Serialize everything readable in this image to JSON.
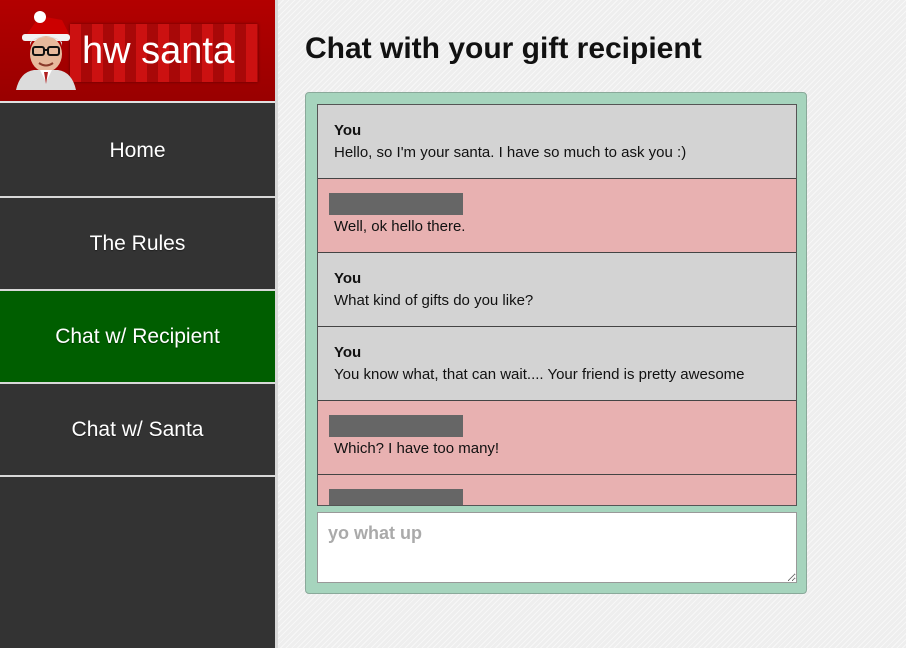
{
  "brand": {
    "logo_text": "hw santa"
  },
  "nav": {
    "items": [
      {
        "label": "Home",
        "active": false
      },
      {
        "label": "The Rules",
        "active": false
      },
      {
        "label": "Chat w/ Recipient",
        "active": true
      },
      {
        "label": "Chat w/ Santa",
        "active": false
      }
    ]
  },
  "page": {
    "title": "Chat with your gift recipient"
  },
  "chat": {
    "messages": [
      {
        "sender": "You",
        "text": "Hello, so I'm your santa. I have so much to ask you :)",
        "from": "you"
      },
      {
        "sender": "",
        "text": "Well, ok hello there.",
        "from": "them"
      },
      {
        "sender": "You",
        "text": "What kind of gifts do you like?",
        "from": "you"
      },
      {
        "sender": "You",
        "text": "You know what, that can wait.... Your friend is pretty awesome",
        "from": "you"
      },
      {
        "sender": "",
        "text": "Which? I have too many!",
        "from": "them"
      },
      {
        "sender": "",
        "text": "",
        "from": "them"
      }
    ],
    "input_placeholder": "yo what up",
    "input_value": ""
  },
  "colors": {
    "sidebar": "#333333",
    "brand_red": "#b30000",
    "nav_active": "#005e00",
    "panel_green": "#a6d4bd",
    "msg_you": "#d3d3d3",
    "msg_them": "#e8b1b1",
    "redaction": "#666666"
  }
}
